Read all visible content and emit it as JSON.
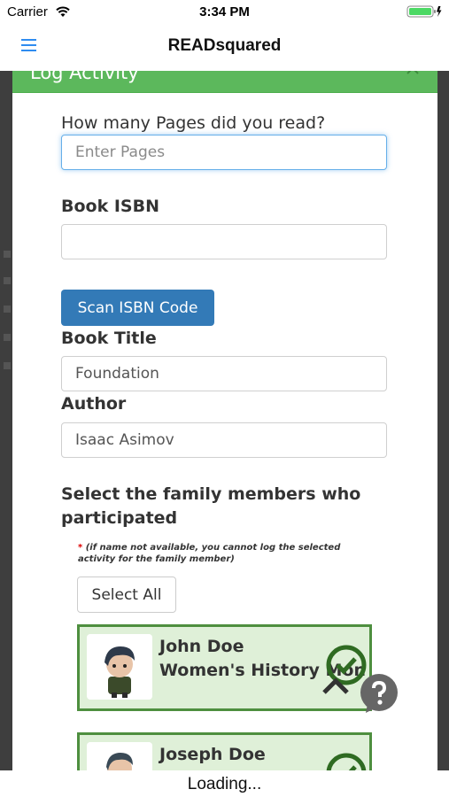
{
  "status_bar": {
    "carrier": "Carrier",
    "time": "3:34 PM"
  },
  "nav": {
    "title": "READsquared",
    "menu_icon": "hamburger-menu-icon"
  },
  "modal": {
    "title": "Log Activity",
    "pages_question": "How many Pages did you read?",
    "pages_placeholder": "Enter Pages",
    "pages_value": "",
    "isbn_label": "Book ISBN",
    "isbn_value": "",
    "scan_button": "Scan ISBN Code",
    "title_label": "Book Title",
    "title_value": "Foundation",
    "author_label": "Author",
    "author_value": "Isaac Asimov",
    "family_heading": "Select the family members who participated",
    "note_star": "*",
    "note_text": "(if name not available, you cannot log the selected activity for the family member)",
    "select_all": "Select All",
    "members": [
      {
        "name": "John Doe",
        "group": "Women's History Mon",
        "selected": true
      },
      {
        "name": "Joseph Doe",
        "group": "",
        "selected": true
      }
    ]
  },
  "loading": "Loading...",
  "colors": {
    "header_green": "#5cb85c",
    "card_bg": "#dff0d8",
    "card_border": "#4e8f3f",
    "primary_blue": "#337ab7",
    "nav_blue": "#2f8cf0"
  }
}
